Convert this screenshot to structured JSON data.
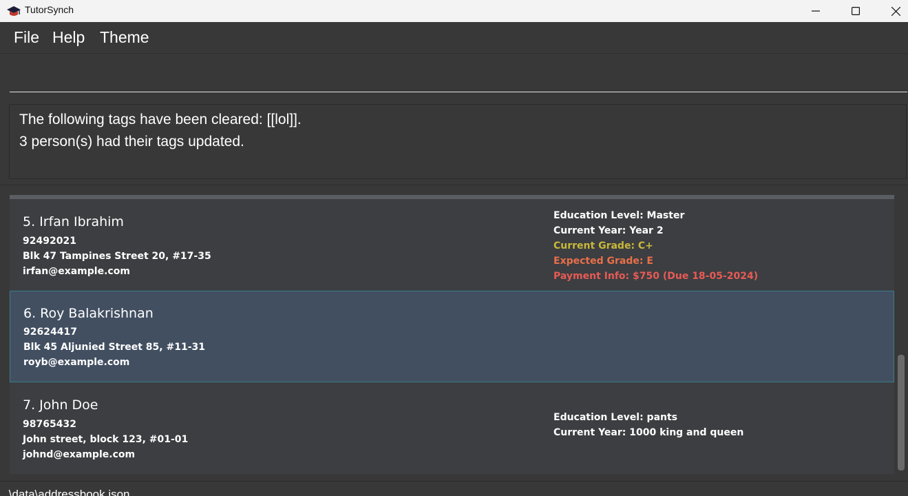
{
  "window": {
    "title": "TutorSynch"
  },
  "menu": {
    "file": "File",
    "help": "Help",
    "theme": "Theme"
  },
  "command": {
    "value": "",
    "placeholder": ""
  },
  "result": {
    "line1": "The following tags have been cleared: [[lol]].",
    "line2": "3 person(s) had their tags updated."
  },
  "persons": [
    {
      "name": "5. Irfan Ibrahim",
      "phone": "92492021",
      "address": "Blk 47 Tampines Street 20, #17-35",
      "email": "irfan@example.com",
      "education_level": "Education Level: Master",
      "current_year": "Current Year: Year 2",
      "current_grade": "Current Grade: C+",
      "expected_grade": "Expected Grade: E",
      "payment_info": "Payment Info: $750 (Due 18-05-2024)",
      "selected": false
    },
    {
      "name": "6. Roy Balakrishnan",
      "phone": "92624417",
      "address": "Blk 45 Aljunied Street 85, #11-31",
      "email": "royb@example.com",
      "selected": true
    },
    {
      "name": "7. John Doe",
      "phone": "98765432",
      "address": "John street, block 123, #01-01",
      "email": "johnd@example.com",
      "education_level": "Education Level: pants",
      "current_year": "Current Year: 1000 king and queen",
      "selected": false
    }
  ],
  "status": {
    "path": ".\\data\\addressbook.json"
  },
  "colors": {
    "background": "#383838",
    "card": "#3c3e41",
    "card_selected": "#424f61",
    "grade_current": "#c9b83a",
    "grade_expected": "#e8704a",
    "payment": "#e85a55"
  },
  "icons": {
    "app": "graduation-cap-icon",
    "minimize": "minimize-icon",
    "maximize": "maximize-icon",
    "close": "close-icon"
  }
}
